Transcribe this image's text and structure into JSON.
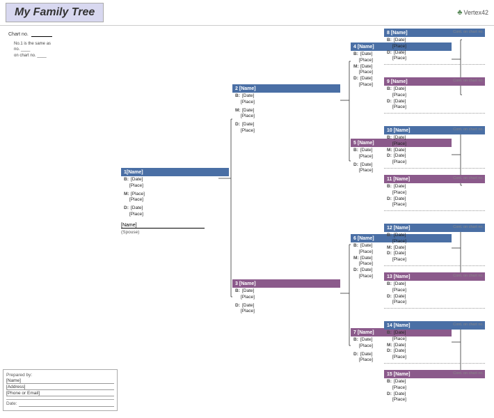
{
  "header": {
    "title": "My Family Tree",
    "logo": "Vertex42",
    "logo_icon": "♣"
  },
  "chart_info": {
    "chart_no_label": "Chart no.",
    "note_line1": "No.1 is the same as",
    "note_line2": "no. ____",
    "note_line3": "on chart no. ____"
  },
  "persons": {
    "p1": {
      "number": "1",
      "name": "[Name]",
      "b_date": "[Date]",
      "b_place": "[Place]",
      "m_date": "[Place]",
      "d_date": "[Date]",
      "d_place": "[Place]",
      "spouse": "[Name]",
      "spouse_label": "(Spouse)"
    },
    "p2": {
      "number": "2",
      "name": "[Name]",
      "b_date": "[Date]",
      "b_place": "[Place]",
      "m_date": "[Date]",
      "m_place": "[Place]",
      "d_date": "[Date]",
      "d_place": "[Place]"
    },
    "p3": {
      "number": "3",
      "name": "[Name]",
      "b_date": "[Date]",
      "b_place": "[Place]",
      "d_date": "[Date]",
      "d_place": "[Place]"
    },
    "p4": {
      "number": "4",
      "name": "[Name]",
      "b_date": "[Date]",
      "b_place": "[Place]",
      "m_date": "[Date]",
      "m_place": "[Place]",
      "d_date": "[Date]",
      "d_place": "[Place]"
    },
    "p5": {
      "number": "5",
      "name": "[Name]",
      "b_date": "[Date]",
      "b_place": "[Place]",
      "d_date": "[Date]",
      "d_place": "[Place]"
    },
    "p6": {
      "number": "6",
      "name": "[Name]",
      "b_date": "[Date]",
      "b_place": "[Place]",
      "m_date": "[Date]",
      "m_place": "[Place]",
      "d_date": "[Date]",
      "d_place": "[Place]"
    },
    "p7": {
      "number": "7",
      "name": "[Name]",
      "b_date": "[Date]",
      "b_place": "[Place]",
      "d_date": "[Date]",
      "d_place": "[Place]"
    },
    "p8": {
      "number": "8",
      "name": "[Name]",
      "b_date": "[Date]",
      "b_place": "[Place]",
      "d_date": "[Date]",
      "d_place": "[Place]",
      "cont": "Cont. on chart no."
    },
    "p9": {
      "number": "9",
      "name": "[Name]",
      "b_date": "[Date]",
      "b_place": "[Place]",
      "d_date": "[Date]",
      "d_place": "[Place]",
      "cont": "Cont. on chart no."
    },
    "p10": {
      "number": "10",
      "name": "[Name]",
      "b_date": "[Date]",
      "b_place": "[Place]",
      "m_date": "[Date]",
      "d_date": "[Date]",
      "d_place": "[Place]",
      "cont": "Cont. on chart no."
    },
    "p11": {
      "number": "11",
      "name": "[Name]",
      "b_date": "[Date]",
      "b_place": "[Place]",
      "d_date": "[Date]",
      "d_place": "[Place]",
      "cont": "Cont. on chart no."
    },
    "p12": {
      "number": "12",
      "name": "[Name]",
      "b_date": "[Date]",
      "b_place": "[Place]",
      "m_date": "[Date]",
      "d_date": "[Date]",
      "d_place": "[Place]",
      "cont": "Cont. on chart no."
    },
    "p13": {
      "number": "13",
      "name": "[Name]",
      "b_date": "[Date]",
      "b_place": "[Place]",
      "d_date": "[Date]",
      "d_place": "[Place]",
      "cont": "Cont. on chart no."
    },
    "p14": {
      "number": "14",
      "name": "[Name]",
      "b_date": "[Date]",
      "b_place": "[Place]",
      "m_date": "[Date]",
      "d_date": "[Date]",
      "d_place": "[Place]",
      "cont": "Cont. on chart no."
    },
    "p15": {
      "number": "15",
      "name": "[Name]",
      "b_date": "[Date]",
      "b_place": "[Place]",
      "d_date": "[Date]",
      "d_place": "[Place]",
      "cont": "Cont. on chart no."
    }
  },
  "labels": {
    "b": "B:",
    "m": "M:",
    "d": "D:",
    "prepared_by": "Prepared by:",
    "name_label": "[Name]",
    "address_label": "[Address]",
    "phone_label": "[Phone or Email]",
    "date_label": "Date:"
  }
}
